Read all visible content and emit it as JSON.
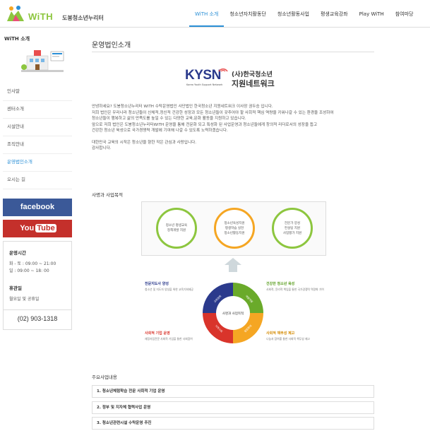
{
  "header": {
    "logo_main": "WiTH",
    "logo_sub": "도봉청소년누리터",
    "nav": [
      {
        "label": "WiTH 소개",
        "active": true
      },
      {
        "label": "청소년자치활동단",
        "active": false
      },
      {
        "label": "청소년활동사업",
        "active": false
      },
      {
        "label": "평생교육강좌",
        "active": false
      },
      {
        "label": "Play WiTH",
        "active": false
      },
      {
        "label": "참여마당",
        "active": false
      }
    ]
  },
  "sidebar": {
    "title": "WiTH 소개",
    "items": [
      {
        "label": "인사말",
        "active": false
      },
      {
        "label": "센터소개",
        "active": false
      },
      {
        "label": "시설안내",
        "active": false
      },
      {
        "label": "조직안내",
        "active": false
      },
      {
        "label": "운영법인소개",
        "active": true
      },
      {
        "label": "오시는 길",
        "active": false
      }
    ],
    "facebook": "facebook",
    "youtube_a": "You",
    "youtube_b": "Tube",
    "hours_title": "운영시간",
    "hours_line1": "화 - 토 : 09:00 ~ 21:00",
    "hours_line2": "일 : 09:00 ~ 18: 00",
    "closed_title": "휴관일",
    "closed_line1": "월요일 및 공휴일",
    "phone": "(02) 903-1318"
  },
  "main": {
    "title": "운영법인소개",
    "kysn": {
      "main": "KYSN",
      "sub": "Korea Youth Support Network",
      "kor1": "(사)한국청소년",
      "kor2": "지원네트워크"
    },
    "intro": [
      "안녕하세요? 도봉청소년누리터 WiTH 수탁운영법인 사단법인 한국청소년 지원네트워크 이사장 권두승 입니다.",
      "저희 법인은 우리나라 청소년들이 신체적,정신적 건강한 성장과 모든 청소년들이 갖추어야 할 사회적 핵심 역량을 키워나갈 수 있는 환경을 조성하여",
      "청소년들이 행복하고 삶의 만족도를 높일 수 있는 다양한 교육,문화 활동을 지원하고 있습니다.",
      "앞으로 저희 법인은 도봉청소년누리터WiTH 운영을 통해 전문화 되고 특성화 된 사업운영과 청소년들에게 창의적 리더로서의 성장을 돕고",
      "건강한 청소년 육성으로 국가경쟁력 개발에 기여해 나갈 수 있도록 노력하겠습니다.",
      "대한민국 교육의 시작은 청소년을 향한 작은 관심과 사랑입니다.",
      "감사합니다."
    ],
    "mission_title": "사명과 사업목적",
    "circles": [
      {
        "line1": "청소년 평생교육",
        "line2": "정책개발 지원",
        "line3": ""
      },
      {
        "line1": "청소년육성지원",
        "line2": "평생학습 실현",
        "line3": "청소년활동지원"
      },
      {
        "line1": "전문가 양성",
        "line2": "컨설팅 지원",
        "line3": "사업평가 지원"
      }
    ],
    "donut_center": "사명과 사업목적",
    "donut_segments": [
      "교육원화",
      "역량개발",
      "협업확대",
      "지역사회"
    ],
    "quadrants": [
      {
        "title": "전문지도사 양성",
        "desc": "청소년 및 지도자 양성을 위한 교육기회제공",
        "color": "#2b3a8c"
      },
      {
        "title": "건강한 청소년 육성",
        "desc": "사회적, 윤리적 책임을 통한 국가경쟁력 역량화 기여",
        "color": "#5a9e1f"
      },
      {
        "title": "사회적 기업 운영",
        "desc": "재정자립전문 사회적 기업을 통한 사회참여",
        "color": "#d9342b"
      },
      {
        "title": "사회적 책무성 제고",
        "desc": "나눔과 참여를 통한 사회적 책무성 제고",
        "color": "#d48a00"
      }
    ],
    "biz_title": "주요사업내용",
    "biz_items": [
      "1. 청소년체험학습 전문 사회적 기업 운영",
      "2. 정부 및 지자체 협력사업 운영",
      "3. 청소년관련시설 수탁운영 추진"
    ]
  },
  "colors": {
    "accent": "#2a8fd6",
    "green": "#8dc63f",
    "orange": "#f5a623",
    "navy": "#2b3a8c"
  }
}
